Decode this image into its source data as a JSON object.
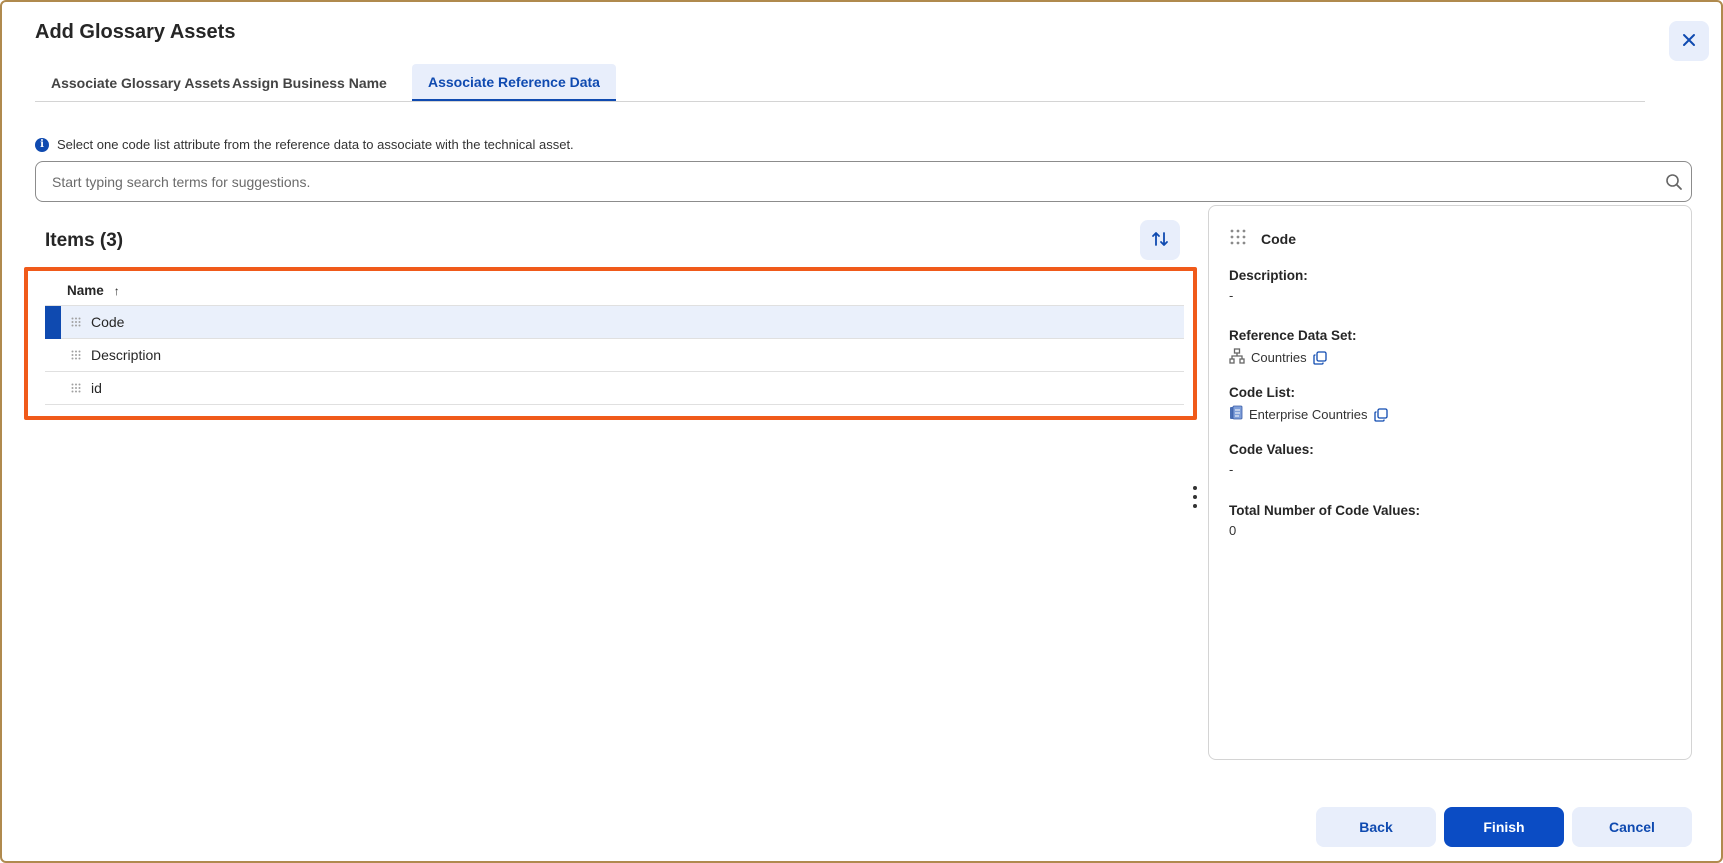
{
  "dialog": {
    "title": "Add Glossary Assets"
  },
  "tabs": [
    {
      "label": "Associate Glossary Assets",
      "active": false
    },
    {
      "label": "Assign Business Name",
      "active": false
    },
    {
      "label": "Associate Reference Data",
      "active": true
    }
  ],
  "info": {
    "message": "Select one code list attribute from the reference data to associate with the technical asset."
  },
  "search": {
    "placeholder": "Start typing search terms for suggestions.",
    "value": ""
  },
  "items": {
    "title": "Items (3)",
    "column_header": "Name",
    "sort_indicator": "↑",
    "rows": [
      {
        "name": "Code",
        "selected": true
      },
      {
        "name": "Description",
        "selected": false
      },
      {
        "name": "id",
        "selected": false
      }
    ]
  },
  "detail": {
    "title": "Code",
    "description_label": "Description:",
    "description_value": "-",
    "ref_set_label": "Reference Data Set:",
    "ref_set_value": "Countries",
    "code_list_label": "Code List:",
    "code_list_value": "Enterprise Countries",
    "code_values_label": "Code Values:",
    "code_values_value": "-",
    "total_label": "Total Number of Code Values:",
    "total_value": "0"
  },
  "footer": {
    "back_label": "Back",
    "finish_label": "Finish",
    "cancel_label": "Cancel"
  },
  "colors": {
    "accent": "#0f4ab0",
    "primary_button": "#0b4cc4",
    "highlight_border": "#f05a1a",
    "selected_row": "#eaf0fb"
  },
  "icons": {
    "close": "close-icon",
    "info": "info-icon",
    "search": "search-icon",
    "sort": "sort-icon",
    "grip": "drag-handle-icon",
    "ref_set": "hierarchy-icon",
    "code_list": "code-list-icon",
    "copy": "copy-icon",
    "more": "kebab-menu-icon"
  }
}
